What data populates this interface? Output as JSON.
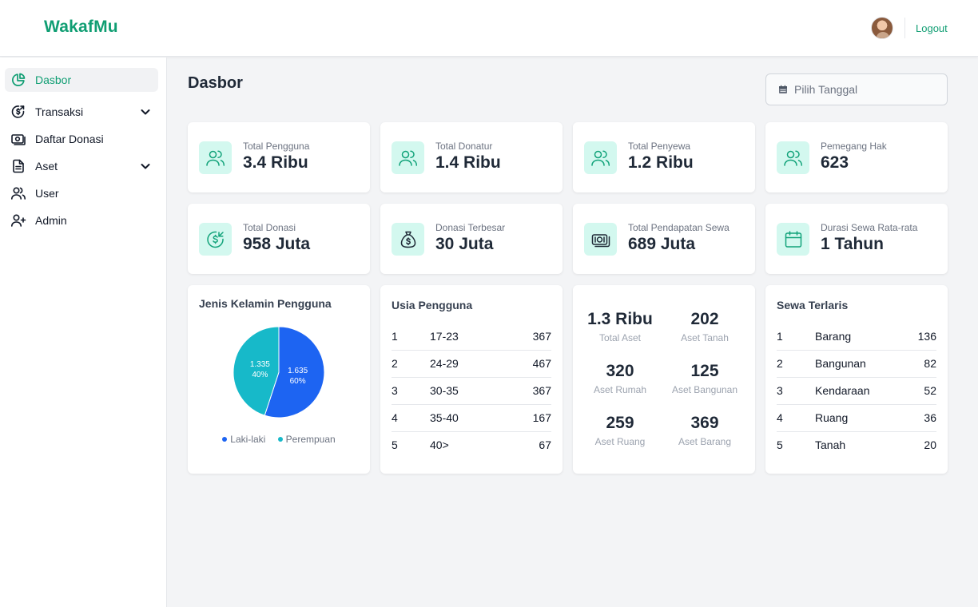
{
  "app": {
    "brand": "WakafMu",
    "logout_label": "Logout"
  },
  "sidebar": {
    "items": [
      {
        "label": "Dasbor",
        "icon": "pie-chart-icon"
      },
      {
        "label": "Transaksi",
        "icon": "dollar-return-icon"
      },
      {
        "label": "Daftar Donasi",
        "icon": "banknote-icon"
      },
      {
        "label": "Aset",
        "icon": "document-icon"
      },
      {
        "label": "User",
        "icon": "users-icon"
      },
      {
        "label": "Admin",
        "icon": "user-add-icon"
      }
    ]
  },
  "page": {
    "title": "Dasbor",
    "date_placeholder": "Pilih Tanggal"
  },
  "stats": [
    {
      "label": "Total Pengguna",
      "value": "3.4 Ribu",
      "icon": "users-icon"
    },
    {
      "label": "Total Donatur",
      "value": "1.4 Ribu",
      "icon": "users-icon"
    },
    {
      "label": "Total Penyewa",
      "value": "1.2 Ribu",
      "icon": "users-icon"
    },
    {
      "label": "Pemegang Hak",
      "value": "623",
      "icon": "users-icon"
    },
    {
      "label": "Total Donasi",
      "value": "958 Juta",
      "icon": "dollar-return-icon"
    },
    {
      "label": "Donasi Terbesar",
      "value": "30 Juta",
      "icon": "money-bag-icon"
    },
    {
      "label": "Total Pendapatan Sewa",
      "value": "689 Juta",
      "icon": "banknote-icon"
    },
    {
      "label": "Durasi Sewa Rata-rata",
      "value": "1 Tahun",
      "icon": "calendar-icon"
    }
  ],
  "gender": {
    "title": "Jenis Kelamin Pengguna",
    "colors": {
      "male": "#1d64f2",
      "female": "#17b9c9"
    }
  },
  "chart_data": {
    "type": "pie",
    "title": "Jenis Kelamin Pengguna",
    "slices": [
      {
        "name": "Laki-laki",
        "value": 1635,
        "value_label": "1.635",
        "percent_label": "60%"
      },
      {
        "name": "Perempuan",
        "value": 1335,
        "value_label": "1.335",
        "percent_label": "40%"
      }
    ],
    "legend": "bottom"
  },
  "age": {
    "title": "Usia Pengguna",
    "rows": [
      {
        "no": "1",
        "range": "17-23",
        "count": "367"
      },
      {
        "no": "2",
        "range": "24-29",
        "count": "467"
      },
      {
        "no": "3",
        "range": "30-35",
        "count": "367"
      },
      {
        "no": "4",
        "range": "35-40",
        "count": "167"
      },
      {
        "no": "5",
        "range": "40>",
        "count": "67"
      }
    ]
  },
  "assets": {
    "items": [
      {
        "value": "1.3 Ribu",
        "label": "Total Aset"
      },
      {
        "value": "202",
        "label": "Aset Tanah"
      },
      {
        "value": "320",
        "label": "Aset Rumah"
      },
      {
        "value": "125",
        "label": "Aset Bangunan"
      },
      {
        "value": "259",
        "label": "Aset Ruang"
      },
      {
        "value": "369",
        "label": "Aset Barang"
      }
    ]
  },
  "rentals": {
    "title": "Sewa Terlaris",
    "rows": [
      {
        "no": "1",
        "name": "Barang",
        "count": "136"
      },
      {
        "no": "2",
        "name": "Bangunan",
        "count": "82"
      },
      {
        "no": "3",
        "name": "Kendaraan",
        "count": "52"
      },
      {
        "no": "4",
        "name": "Ruang",
        "count": "36"
      },
      {
        "no": "5",
        "name": "Tanah",
        "count": "20"
      }
    ]
  }
}
